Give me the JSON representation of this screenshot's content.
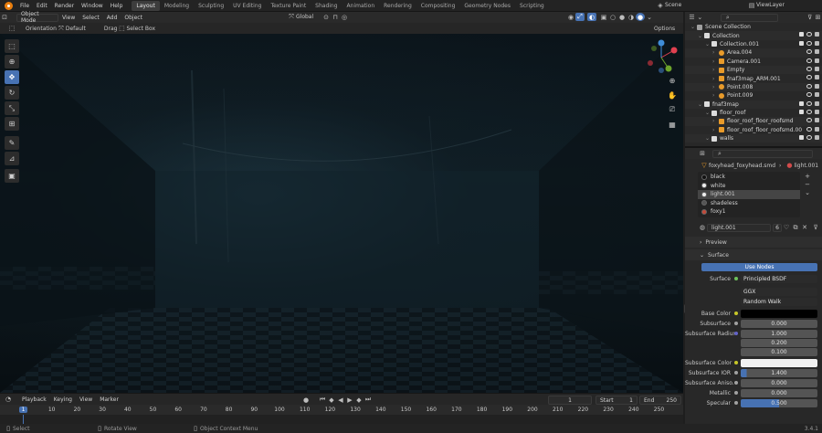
{
  "topbar": {
    "menus": [
      "File",
      "Edit",
      "Render",
      "Window",
      "Help"
    ],
    "workspaces": [
      "Layout",
      "Modeling",
      "Sculpting",
      "UV Editing",
      "Texture Paint",
      "Shading",
      "Animation",
      "Rendering",
      "Compositing",
      "Geometry Nodes",
      "Scripting"
    ],
    "active_workspace": "Layout",
    "scene": "Scene",
    "view_layer": "ViewLayer"
  },
  "viewport_header": {
    "mode": "Object Mode",
    "menus": [
      "View",
      "Select",
      "Add",
      "Object"
    ],
    "transform_orientation": "Global",
    "orientation_label": "Orientation",
    "orientation_value": "Default",
    "drag_label": "Drag",
    "drag_value": "Select Box",
    "options_label": "Options"
  },
  "outliner": {
    "search_placeholder": "",
    "rows": [
      {
        "label": "Scene Collection",
        "indent": 0,
        "type": "scene"
      },
      {
        "label": "Collection",
        "indent": 1,
        "type": "collection"
      },
      {
        "label": "Collection.001",
        "indent": 2,
        "type": "collection"
      },
      {
        "label": "Area.004",
        "indent": 3,
        "type": "light"
      },
      {
        "label": "Camera.001",
        "indent": 3,
        "type": "camera"
      },
      {
        "label": "Empty",
        "indent": 3,
        "type": "empty"
      },
      {
        "label": "fnaf3map_ARM.001",
        "indent": 3,
        "type": "armature"
      },
      {
        "label": "Point.008",
        "indent": 3,
        "type": "light"
      },
      {
        "label": "Point.009",
        "indent": 3,
        "type": "light"
      },
      {
        "label": "fnaf3map",
        "indent": 1,
        "type": "collection"
      },
      {
        "label": "floor_roof",
        "indent": 2,
        "type": "collection"
      },
      {
        "label": "floor_roof_floor_roofsmd",
        "indent": 3,
        "type": "mesh"
      },
      {
        "label": "floor_roof_floor_roofsmd.00",
        "indent": 3,
        "type": "mesh"
      },
      {
        "label": "walls",
        "indent": 2,
        "type": "collection"
      }
    ]
  },
  "properties": {
    "breadcrumb_object": "foxyhead_foxyhead.smd",
    "breadcrumb_material": "light.001",
    "material_slots": [
      "black",
      "white",
      "light.001",
      "shadeless",
      "foxy1"
    ],
    "selected_slot": "light.001",
    "material_name": "light.001",
    "user_count": "6",
    "preview_label": "Preview",
    "surface_panel_label": "Surface",
    "use_nodes_label": "Use Nodes",
    "surface_label": "Surface",
    "surface_shader": "Principled BSDF",
    "distribution": "GGX",
    "subsurface_method": "Random Walk",
    "fields": {
      "base_color_label": "Base Color",
      "subsurface_label": "Subsurface",
      "subsurface_value": "0.000",
      "subsurface_radius_label": "Subsurface Radius",
      "subsurface_radius": [
        "1.000",
        "0.200",
        "0.100"
      ],
      "subsurface_color_label": "Subsurface Color",
      "subsurface_ior_label": "Subsurface IOR",
      "subsurface_ior_value": "1.400",
      "subsurface_aniso_label": "Subsurface Aniso...",
      "subsurface_aniso_value": "0.000",
      "metallic_label": "Metallic",
      "metallic_value": "0.000",
      "specular_label": "Specular",
      "specular_value": "0.500"
    },
    "colors": {
      "base_color": "#000000",
      "subsurface_color": "#f0f0f0"
    }
  },
  "timeline": {
    "menus": [
      "Playback",
      "Keying",
      "View",
      "Marker"
    ],
    "current_frame": "1",
    "start_label": "Start",
    "start_value": "1",
    "end_label": "End",
    "end_value": "250",
    "ruler": [
      "1",
      "10",
      "20",
      "30",
      "40",
      "50",
      "60",
      "70",
      "80",
      "90",
      "100",
      "110",
      "120",
      "130",
      "140",
      "150",
      "160",
      "170",
      "180",
      "190",
      "200",
      "210",
      "220",
      "230",
      "240",
      "250"
    ]
  },
  "statusbar": {
    "select": "Select",
    "rotate_view": "Rotate View",
    "context_menu": "Object Context Menu",
    "version": "3.4.1"
  }
}
